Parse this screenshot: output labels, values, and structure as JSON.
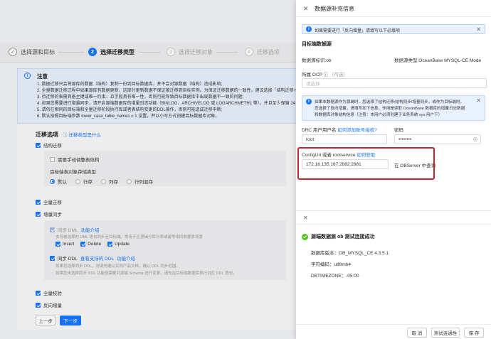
{
  "steps": [
    {
      "num": "✓",
      "label": "选择源和目标",
      "state": "done"
    },
    {
      "num": "2",
      "label": "选择迁移类型",
      "state": "active"
    },
    {
      "num": "3",
      "label": "选择迁移对象",
      "state": "pending"
    },
    {
      "num": "4",
      "label": "迁移选项",
      "state": "pending"
    }
  ],
  "notice": {
    "title": "注意",
    "lines": [
      "1. 数据迁移只会将源库的数据（结构）复制一份到目标数据库，并不会对源数据（结构）造成影响;",
      "2. 全量数据迁移过程中如果源库有数据更新，这部分更新数据不保证被迁移到目标实例。为保证迁移数据的一致性，建议选择「结构迁移+全量迁",
      "3. 待迁移的表需具备主键或唯一约束，且字段具有唯一性，否则可能导致目标数据库中出现数据不一致的问题;",
      "4. 如果您需要进行增量同步，请开启源端数据库的增量日志功能（BINLOG、ARCHIVELOG 或 LOGARCHMETH1 等），并且至少保留 24 个小时",
      "5. 请勿在相同的目标端和全量迁移阶段执行库或者表结构变更的DDL操作，否则可能造成迁移中断;",
      "6. 默认按照目标端参数 lower_case_table_names = 1 设置，并以小写方式创建目标数据库对象。"
    ]
  },
  "migration": {
    "section_title": "迁移选项",
    "what_is_link": "迁移类型是什么",
    "schema": "结构迁移",
    "manual_adjust": "需要手动调整表结构",
    "storage_label": "目标端表对象存储类型",
    "storage_options": [
      "默认",
      "行存",
      "列存",
      "行列混存"
    ],
    "full": "全量迁移",
    "incr": "增量同步",
    "dml_label": "同步 DML",
    "dml_link": "功能介绍",
    "dml_desc": "支持被选择的 DML 语句同步至目标端，常用于区逻辑分库分表或者等相同数据表场景",
    "dml_ops": [
      "Insert",
      "Delete",
      "Update"
    ],
    "ddl_label": "同步 DDL",
    "ddl_link1": "查看支持的 DDL",
    "ddl_link2": "功能介绍",
    "ddl_desc1": "如果您选择同步 DDL，则请先确认实例产品文档，确认 DDL 同步范围。",
    "ddl_desc2": "如果您未选择同步 DDL 功能但需要对源端 Schema 进行变更，请先在目标端数据库执行对应 DDL 语句。",
    "verify": "全量校验",
    "reverse": "反向增量",
    "prev_btn": "上一步",
    "next_btn": "下一步"
  },
  "drawer": {
    "title": "数据源补充信息",
    "alert1": "如果需要进行「反向增量」请填写以下必填项",
    "target_section": "目标端数据源",
    "ds_id": "数据源标识:ob",
    "ds_type": "数据源类型:OceanBase MYSQL-CE Mode",
    "ocp_label": "所属 OCP",
    "ocp_optional": "（可选）",
    "ocp_placeholder": "请选择",
    "alert2_lines": [
      "如果本数据源作为源端时，您选择了结构迁移/结构同步/增量同步，或作为目标端时，",
      "您选择了反向增量，请填写如下信息，作用是读取 OceanBase 数据库的增量日志数据",
      "和数据库对象结构信息（注意：本用户必须创建于业务系统 sys 用户下）"
    ],
    "drc_label": "DRC 用户用户名",
    "drc_link": "如何添加账号授权?",
    "drc_value": "root",
    "pwd_label": "密码",
    "pwd_value": "••••••••",
    "cfg_label": "ConfigUrl 或者 rootservice",
    "cfg_link": "如何获取",
    "cfg_value": "172.16.135.167:2882:2881",
    "cfg_query": "在 OBServer 中查询"
  },
  "test": {
    "success_title": "源端数据源 ob 测试连接成功",
    "version": "数据库版本：OB_MYSQL_CE 4.3.5.1",
    "charset": "字符编码：utf8mb4",
    "timezone": "DBTIMEZONE：-05:00"
  },
  "footer": {
    "cancel": "取 消",
    "test_btn": "测试连通性",
    "save": "保 存"
  }
}
